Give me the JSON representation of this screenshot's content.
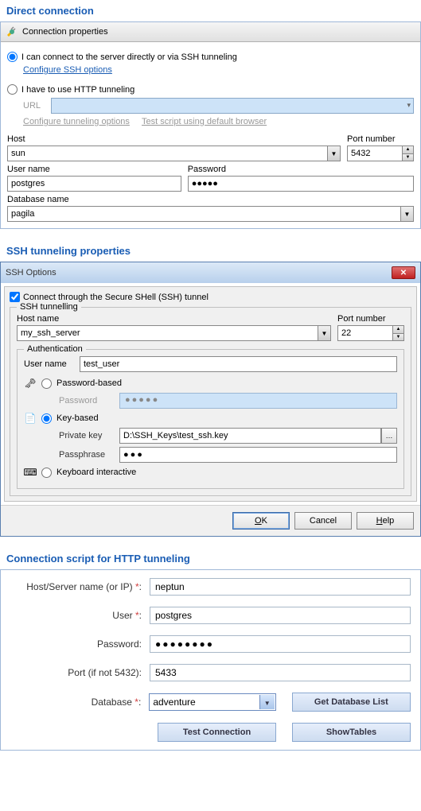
{
  "section1": {
    "title": "Direct connection",
    "panel_header": "Connection properties",
    "radio_direct": "I can connect to the server directly or via SSH tunneling",
    "configure_ssh_link": "Configure SSH options",
    "radio_http": "I have to use HTTP tunneling",
    "url_label": "URL",
    "configure_tunnel_link": "Configure tunneling options",
    "test_script_link": "Test script using default browser",
    "host_label": "Host",
    "host_value": "sun",
    "port_label": "Port number",
    "port_value": "5432",
    "user_label": "User name",
    "user_value": "postgres",
    "pw_label": "Password",
    "pw_value": "●●●●●",
    "db_label": "Database name",
    "db_value": "pagila"
  },
  "section2": {
    "title": "SSH tunneling properties",
    "dialog_title": "SSH Options",
    "connect_chk": "Connect through the Secure SHell (SSH) tunnel",
    "group_tunnel": "SSH tunnelling",
    "host_label": "Host name",
    "host_value": "my_ssh_server",
    "port_label": "Port number",
    "port_value": "22",
    "group_auth": "Authentication",
    "user_label": "User name",
    "user_value": "test_user",
    "radio_pw": "Password-based",
    "pw_label": "Password",
    "pw_disabled_value": "●●●●●",
    "radio_key": "Key-based",
    "key_label": "Private key",
    "key_value": "D:\\SSH_Keys\\test_ssh.key",
    "passphrase_label": "Passphrase",
    "passphrase_value": "●●●",
    "radio_kb": "Keyboard interactive",
    "btn_ok": "OK",
    "btn_cancel": "Cancel",
    "btn_help": "Help"
  },
  "section3": {
    "title": "Connection script for HTTP tunneling",
    "host_label": "Host/Server name (or IP)",
    "host_value": "neptun",
    "user_label": "User",
    "user_value": "postgres",
    "pw_label": "Password:",
    "pw_value": "●●●●●●●●",
    "port_label": "Port (if not 5432):",
    "port_value": "5433",
    "db_label": "Database",
    "db_value": "adventure",
    "btn_getdb": "Get Database List",
    "btn_test": "Test Connection",
    "btn_show": "ShowTables"
  }
}
